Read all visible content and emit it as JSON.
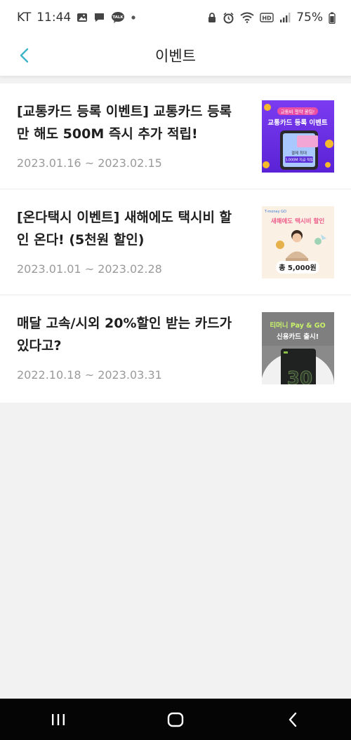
{
  "status": {
    "carrier": "KT",
    "time": "11:44",
    "battery": "75%",
    "hd_label": "HD",
    "talk_label": "TALK"
  },
  "header": {
    "title": "이벤트",
    "back_icon": "chevron-left-icon",
    "accent": "#3cb4c8"
  },
  "events": [
    {
      "title": "[교통카드 등록 이벤트] 교통카드 등록만 해도 500M 즉시 추가 적립!",
      "date": "2023.01.16 ~ 2023.02.15",
      "thumb": {
        "top": "교통비 절약 꿀팁!",
        "main": "교통카드 등록 이벤트",
        "sub1": "결제 최대",
        "sub2": "3,000M 지급 적립"
      }
    },
    {
      "title": "[온다택시 이벤트] 새해에도 택시비 할인 온다! (5천원 할인)",
      "date": "2023.01.01 ~ 2023.02.28",
      "thumb": {
        "brand": "T-money GO",
        "main": "새해에도 택시비 할인",
        "amount": "총 5,000원"
      }
    },
    {
      "title": "매달 고속/시외 20%할인 받는 카드가 있다고?",
      "date": "2022.10.18 ~ 2023.03.31",
      "thumb": {
        "line1": "티머니 Pay & GO",
        "line2": "신용카드 출시!",
        "card_text": "30"
      }
    }
  ]
}
